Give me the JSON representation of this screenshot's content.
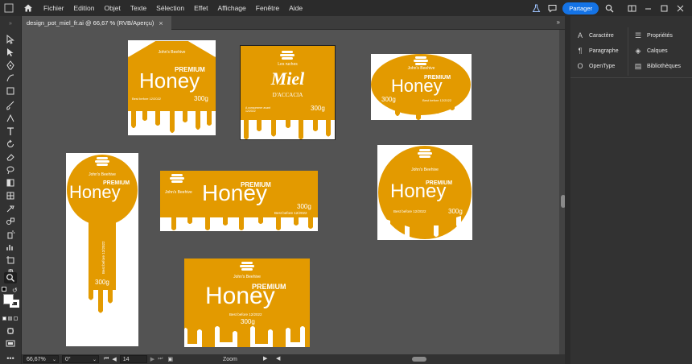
{
  "menubar": {
    "items": [
      "Fichier",
      "Edition",
      "Objet",
      "Texte",
      "Sélection",
      "Effet",
      "Affichage",
      "Fenêtre",
      "Aide"
    ],
    "share_label": "Partager"
  },
  "document_tab": {
    "title": "design_pot_miel_fr.ai @ 66,67 % (RVB/Aperçu)"
  },
  "right_panel": {
    "col1": [
      "Caractère",
      "Paragraphe",
      "OpenType"
    ],
    "col2": [
      "Propriétés",
      "Calques",
      "Bibliothèques"
    ]
  },
  "statusbar": {
    "zoom": "66,67%",
    "angle": "0°",
    "page": "14",
    "zoom_label": "Zoom"
  },
  "labels": {
    "brand": "John's Beehive",
    "premium": "PREMIUM",
    "product": "Honey",
    "weight": "300g",
    "best_before": "Best before 12/2022",
    "miel_brand": "Les ruches",
    "miel_product": "Miel",
    "miel_variety": "D'ACCACIA",
    "miel_best_before": "A consommer avant 12/2022"
  },
  "colors": {
    "honey": "#e39a00",
    "accent_blue": "#1473e6",
    "canvas": "#535353"
  }
}
